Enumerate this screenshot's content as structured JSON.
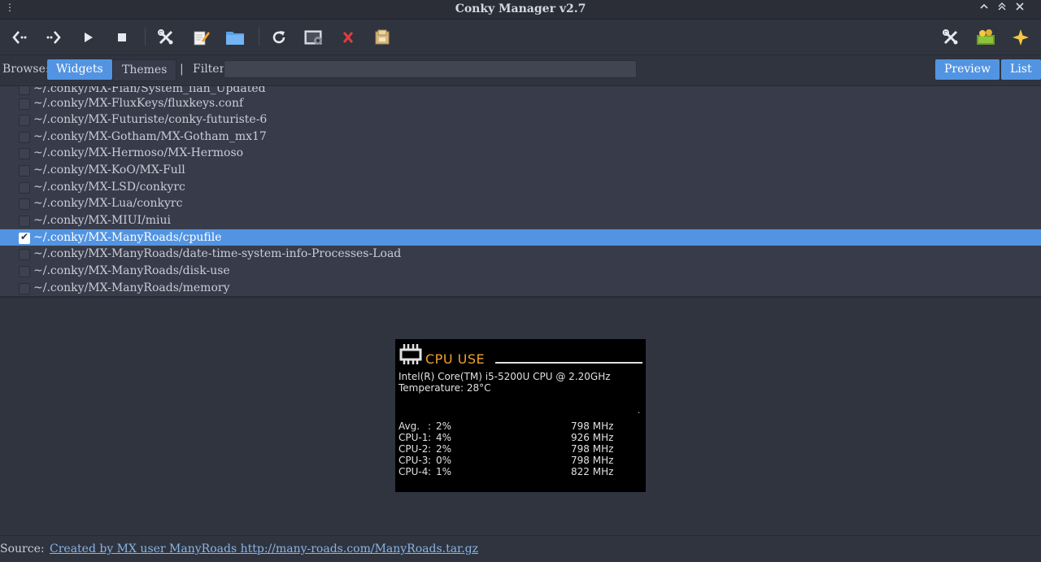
{
  "window": {
    "title": "Conky Manager v2.7",
    "menu_glyph": "⋮",
    "controls": {
      "minimize": "⌃",
      "maximize": "⌃",
      "close": "✕"
    }
  },
  "toolbar": {
    "left": [
      "back-icon",
      "forward-icon",
      "play-icon",
      "stop-icon",
      "tools-icon",
      "edit-icon",
      "folder-icon",
      "refresh-icon",
      "settings-icon",
      "delete-icon",
      "archive-icon"
    ],
    "right": [
      "tools-icon",
      "cash-icon",
      "star-icon"
    ],
    "colors": {
      "icon_light": "#e6e9ee",
      "delete": "#e03c3c",
      "folder": "#5aa0e6",
      "star": "#f5c842"
    }
  },
  "browse": {
    "label": "Browse:",
    "tab_widgets": "Widgets",
    "tab_themes": "Themes",
    "separator": "|",
    "filter_label": "Filter",
    "filter_value": "",
    "preview_button": "Preview",
    "list_button": "List"
  },
  "list": {
    "items": [
      {
        "path": "~/.conky/MX-Fian/System_fian_Updated",
        "checked": false
      },
      {
        "path": "~/.conky/MX-FluxKeys/fluxkeys.conf",
        "checked": false
      },
      {
        "path": "~/.conky/MX-Futuriste/conky-futuriste-6",
        "checked": false
      },
      {
        "path": "~/.conky/MX-Gotham/MX-Gotham_mx17",
        "checked": false
      },
      {
        "path": "~/.conky/MX-Hermoso/MX-Hermoso",
        "checked": false
      },
      {
        "path": "~/.conky/MX-KoO/MX-Full",
        "checked": false
      },
      {
        "path": "~/.conky/MX-LSD/conkyrc",
        "checked": false
      },
      {
        "path": "~/.conky/MX-Lua/conkyrc",
        "checked": false
      },
      {
        "path": "~/.conky/MX-MIUI/miui",
        "checked": false
      },
      {
        "path": "~/.conky/MX-ManyRoads/cpufile",
        "checked": true
      },
      {
        "path": "~/.conky/MX-ManyRoads/date-time-system-info-Processes-Load",
        "checked": false
      },
      {
        "path": "~/.conky/MX-ManyRoads/disk-use",
        "checked": false
      },
      {
        "path": "~/.conky/MX-ManyRoads/memory",
        "checked": false
      }
    ]
  },
  "preview": {
    "heading": "CPU USE",
    "cpu_name": "Intel(R) Core(TM) i5-5200U CPU @ 2.20GHz",
    "temperature": "Temperature: 28°C",
    "dot": ".",
    "rows": [
      {
        "name": "Avg.",
        "sep": ":",
        "pct": "2%",
        "freq": "798 MHz"
      },
      {
        "name": "CPU-1",
        "sep": ":",
        "pct": "4%",
        "freq": "926 MHz"
      },
      {
        "name": "CPU-2",
        "sep": ":",
        "pct": "2%",
        "freq": "798 MHz"
      },
      {
        "name": "CPU-3",
        "sep": ":",
        "pct": "0%",
        "freq": "798 MHz"
      },
      {
        "name": "CPU-4",
        "sep": ":",
        "pct": "1%",
        "freq": "822 MHz"
      }
    ],
    "colors": {
      "heading": "#f0a030",
      "text": "#e0e0e0",
      "background": "#000000"
    }
  },
  "source": {
    "label": "Source:",
    "link_text": "Created by MX user ManyRoads http://many-roads.com/ManyRoads.tar.gz"
  },
  "colors": {
    "accent": "#5294e2",
    "bg": "#2f343f",
    "list_bg": "#383c4a"
  }
}
